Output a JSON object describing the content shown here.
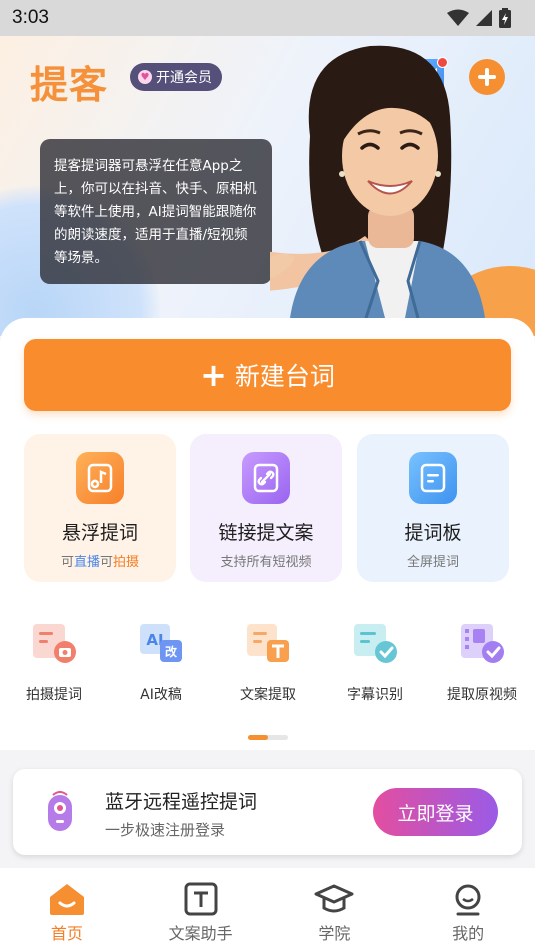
{
  "status_bar": {
    "time": "3:03"
  },
  "header": {
    "logo": "提客",
    "vip_label": "开通会员",
    "intro_text": "提客提词器可悬浮在任意App之上，你可以在抖音、快手、原相机等软件上使用，AI提词智能跟随你的朗读速度，适用于直播/短视频等场景。"
  },
  "main": {
    "new_script_label": "新建台词",
    "features": [
      {
        "title": "悬浮提词",
        "sub_parts": [
          "可",
          "直播",
          "可",
          "拍摄"
        ]
      },
      {
        "title": "链接提文案",
        "sub": "支持所有短视频"
      },
      {
        "title": "提词板",
        "sub": "全屏提词"
      }
    ],
    "tools": [
      {
        "label": "拍摄提词",
        "icon": "camera-script-icon"
      },
      {
        "label": "AI改稿",
        "icon": "ai-rewrite-icon"
      },
      {
        "label": "文案提取",
        "icon": "text-extract-icon"
      },
      {
        "label": "字幕识别",
        "icon": "subtitle-recognize-icon"
      },
      {
        "label": "提取原视频",
        "icon": "video-extract-icon"
      }
    ]
  },
  "bluetooth_banner": {
    "title": "蓝牙远程遥控提词",
    "sub": "一步极速注册登录",
    "button": "立即登录"
  },
  "bottom_nav": {
    "items": [
      {
        "label": "首页",
        "icon": "home-icon",
        "active": true
      },
      {
        "label": "文案助手",
        "icon": "copywriting-icon",
        "active": false
      },
      {
        "label": "学院",
        "icon": "academy-icon",
        "active": false
      },
      {
        "label": "我的",
        "icon": "profile-icon",
        "active": false
      }
    ]
  },
  "colors": {
    "accent": "#f98d2e",
    "link_blue": "#4a86e8",
    "login_gradient_start": "#e34ea0",
    "login_gradient_end": "#9a5be6"
  }
}
